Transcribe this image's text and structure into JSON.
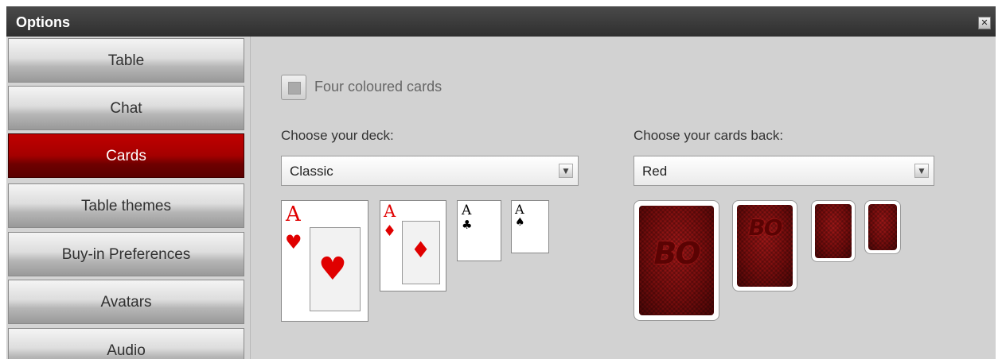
{
  "window": {
    "title": "Options",
    "close_glyph": "✕"
  },
  "sidebar": {
    "items": [
      {
        "label": "Table",
        "active": false
      },
      {
        "label": "Chat",
        "active": false
      },
      {
        "label": "Cards",
        "active": true
      },
      {
        "label": "Table themes",
        "active": false
      },
      {
        "label": "Buy-in Preferences",
        "active": false
      },
      {
        "label": "Avatars",
        "active": false
      },
      {
        "label": "Audio",
        "active": false
      }
    ]
  },
  "options": {
    "four_coloured_label": "Four coloured cards",
    "four_coloured_checked": false
  },
  "deck": {
    "heading": "Choose your deck:",
    "selected": "Classic",
    "preview_rank": "A",
    "preview_suits": [
      "♥",
      "♦",
      "♣",
      "♠"
    ]
  },
  "cards_back": {
    "heading": "Choose your cards back:",
    "selected": "Red",
    "logo_text": "BO"
  },
  "colors": {
    "active_tab": "#a40000",
    "titlebar": "#3a3a3a",
    "panel_bg": "#d2d2d2",
    "red_suit": "#e00000"
  }
}
